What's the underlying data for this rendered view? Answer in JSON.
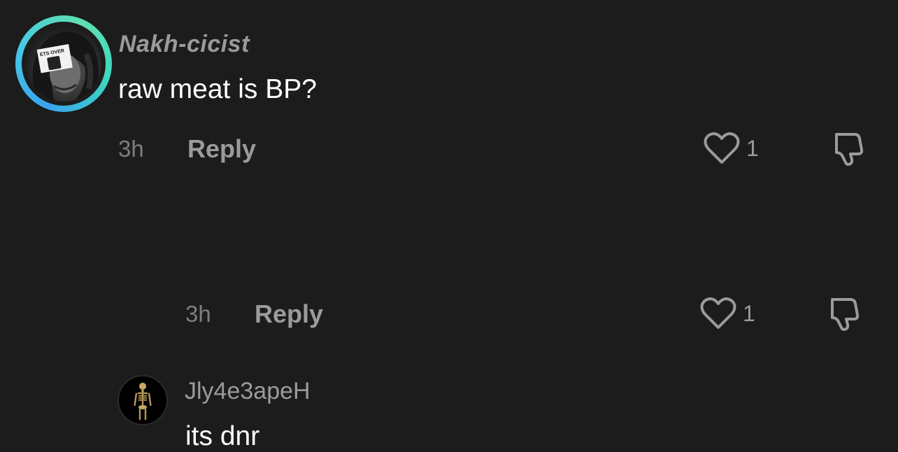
{
  "comments": [
    {
      "username": "Nakh-cicist",
      "avatar_badge": "ETS OVER",
      "text": "raw meat is BP?",
      "time": "3h",
      "reply_label": "Reply",
      "likes": "1",
      "icons": {
        "like": "heart-outline-icon",
        "dislike": "thumbs-down-icon"
      }
    },
    {
      "username": "Jly4e3apeH",
      "text": "its dnr",
      "time": "3h",
      "reply_label": "Reply",
      "likes": "1",
      "icons": {
        "like": "heart-outline-icon",
        "dislike": "thumbs-down-icon"
      }
    }
  ],
  "colors": {
    "background": "#1c1c1c",
    "primary_text": "#ffffff",
    "secondary_text": "#9b9b9b",
    "ring_gradient": [
      "#3aa3f0",
      "#5fe0b0"
    ]
  }
}
